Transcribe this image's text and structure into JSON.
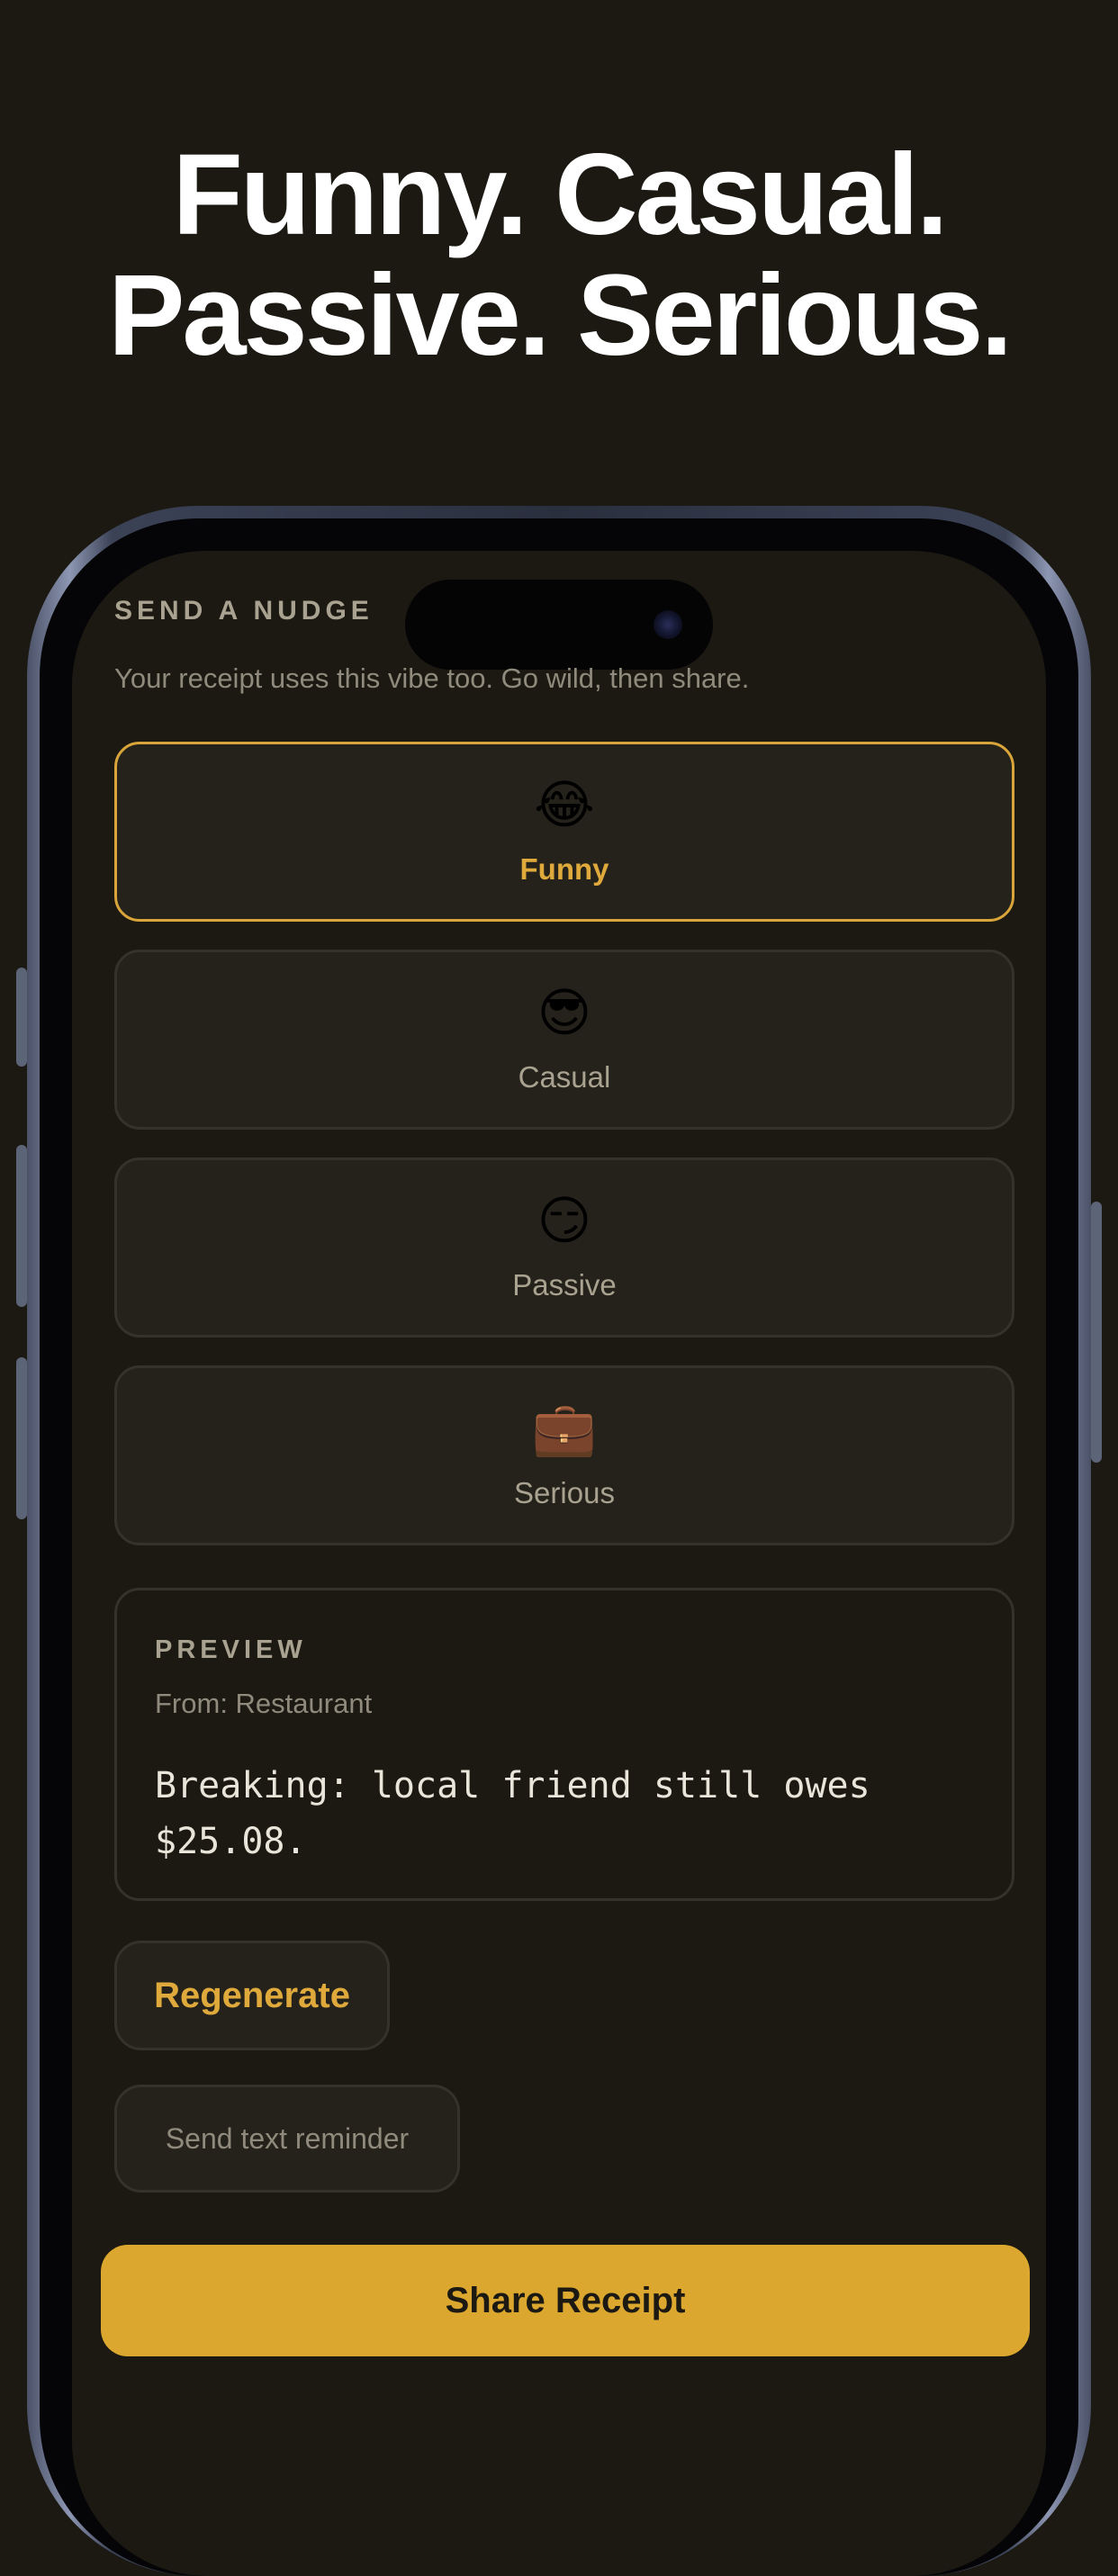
{
  "headline": {
    "line1": "Funny. Casual.",
    "line2": "Passive. Serious."
  },
  "screen": {
    "section_label": "SEND A NUDGE",
    "subtitle": "Your receipt uses this vibe too. Go wild, then share.",
    "vibes": [
      {
        "emoji": "😂",
        "label": "Funny",
        "selected": true
      },
      {
        "emoji": "😎",
        "label": "Casual",
        "selected": false
      },
      {
        "emoji": "😏",
        "label": "Passive",
        "selected": false
      },
      {
        "emoji": "💼",
        "label": "Serious",
        "selected": false
      }
    ],
    "preview": {
      "title": "PREVIEW",
      "from": "From: Restaurant",
      "message": "Breaking: local friend still owes $25.08."
    },
    "regenerate_label": "Regenerate",
    "send_text_label": "Send text reminder",
    "share_label": "Share Receipt"
  },
  "colors": {
    "background": "#1b1912",
    "accent": "#dca72f",
    "card": "#24221a",
    "card_border": "#35322a"
  }
}
